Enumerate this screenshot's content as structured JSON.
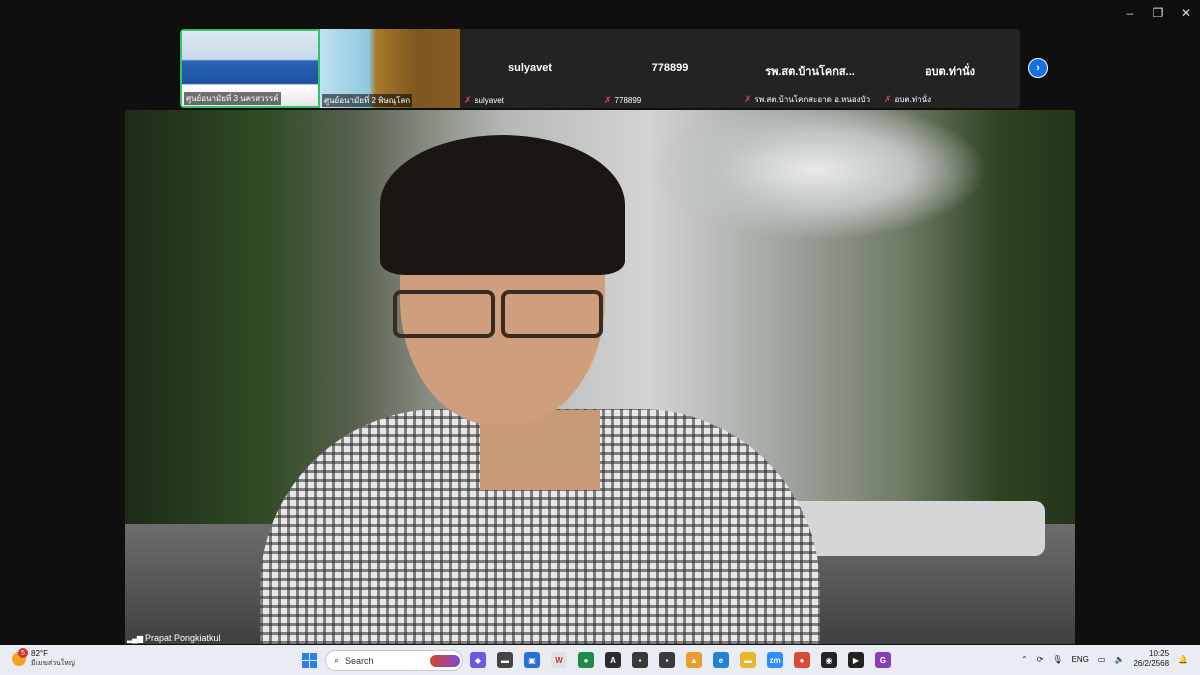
{
  "window": {
    "minimize": "–",
    "restore": "❐",
    "close": "✕"
  },
  "strip": {
    "tiles": [
      {
        "name": "",
        "label": "ศูนย์อนามัยที่ 3 นครสวรรค์"
      },
      {
        "name": "",
        "label": "ศูนย์อนามัยที่ 2 พิษณุโลก"
      },
      {
        "name": "sulyavet",
        "label": "sulyavet"
      },
      {
        "name": "778899",
        "label": "778899"
      },
      {
        "name": "รพ.สต.บ้านโคกส...",
        "label": "รพ.สต.บ้านโคกสะอาด อ.หนองบัว"
      },
      {
        "name": "อบต.ท่านั่ง",
        "label": "อบต.ท่านั่ง"
      }
    ],
    "next_arrow": "›"
  },
  "main": {
    "speaker_name": "Prapat Pongkiatkul",
    "signal_bars": "▂▄▆"
  },
  "taskbar": {
    "weather_temp": "82°F",
    "weather_desc": "มีเมฆส่วนใหญ่",
    "weather_badge": "5",
    "search_label": "Search",
    "apps": [
      {
        "icon": "copilot-icon",
        "glyph": "◆",
        "color": "#6a5ae0"
      },
      {
        "icon": "files-icon",
        "glyph": "▬",
        "color": "#444"
      },
      {
        "icon": "store-icon",
        "glyph": "▣",
        "color": "#2a6fd6"
      },
      {
        "icon": "w-icon",
        "glyph": "W",
        "color": "#e1e1e1"
      },
      {
        "icon": "app-green-icon",
        "glyph": "●",
        "color": "#1e8b47"
      },
      {
        "icon": "app-a-icon",
        "glyph": "A",
        "color": "#2b2b2b"
      },
      {
        "icon": "app-gray1-icon",
        "glyph": "▪",
        "color": "#3a3a3a"
      },
      {
        "icon": "app-gray2-icon",
        "glyph": "▪",
        "color": "#3a3a3a"
      },
      {
        "icon": "photos-icon",
        "glyph": "▲",
        "color": "#e8a02c"
      },
      {
        "icon": "edge-icon",
        "glyph": "e",
        "color": "#1f83d8"
      },
      {
        "icon": "folder-icon",
        "glyph": "▬",
        "color": "#e8b52c"
      },
      {
        "icon": "zoom-icon",
        "glyph": "zm",
        "color": "#2d8cff"
      },
      {
        "icon": "chrome-icon",
        "glyph": "●",
        "color": "#d94a38"
      },
      {
        "icon": "app-dark-icon",
        "glyph": "◉",
        "color": "#222"
      },
      {
        "icon": "media-icon",
        "glyph": "▶",
        "color": "#222"
      },
      {
        "icon": "app-g-icon",
        "glyph": "G",
        "color": "#8a3fb0"
      }
    ],
    "lang": "ENG",
    "time": "10:25",
    "date": "26/2/2568"
  }
}
